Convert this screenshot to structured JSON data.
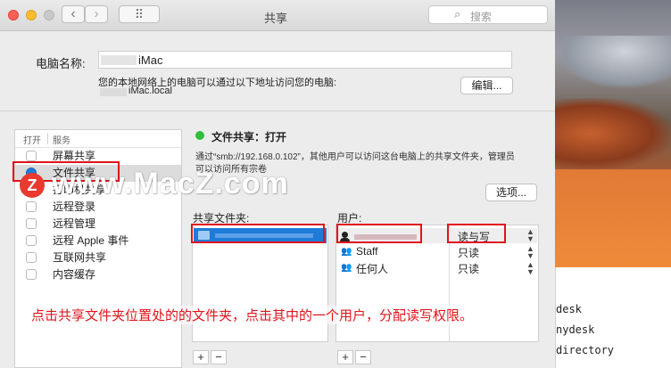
{
  "window": {
    "title": "共享",
    "back_glyph": "‹",
    "forward_glyph": "›",
    "grid_glyph": "⠿",
    "search_placeholder": "搜索",
    "search_icon_glyph": "⌕"
  },
  "computer": {
    "name_label": "电脑名称:",
    "name_value": "iMac",
    "access_text": "您的本地网络上的电脑可以通过以下地址访问您的电脑:",
    "local_address": "iMac.local",
    "edit_button": "编辑..."
  },
  "services": {
    "header_on": "打开",
    "header_service": "服务",
    "items": [
      {
        "label": "屏幕共享",
        "checked": false,
        "selected": false
      },
      {
        "label": "文件共享",
        "checked": true,
        "selected": true
      },
      {
        "label": "打印机共享",
        "checked": false,
        "selected": false
      },
      {
        "label": "远程登录",
        "checked": false,
        "selected": false
      },
      {
        "label": "远程管理",
        "checked": false,
        "selected": false
      },
      {
        "label": "远程 Apple 事件",
        "checked": false,
        "selected": false
      },
      {
        "label": "互联网共享",
        "checked": false,
        "selected": false
      },
      {
        "label": "内容缓存",
        "checked": false,
        "selected": false
      }
    ]
  },
  "file_sharing": {
    "status": "文件共享：打开",
    "status_color": "#2fbf3a",
    "description_line1": "通过“smb://192.168.0.102”，其他用户可以访问这台电脑上的共享文件夹，管理员",
    "description_line2": "可以访问所有宗卷",
    "options_button": "选项...",
    "shared_folders_label": "共享文件夹:",
    "users_label": "用户:",
    "users": [
      {
        "name": "",
        "permission": "读与写"
      },
      {
        "name": "Staff",
        "permission": "只读"
      },
      {
        "name": "任何人",
        "permission": "只读"
      }
    ],
    "add_glyph": "+",
    "remove_glyph": "−"
  },
  "watermark": "www.MacZ.com",
  "watermark_logo_letter": "Z",
  "annotation": "点击共享文件夹位置处的的文件夹，点击其中的一个用户，分配读写权限。",
  "terminal_lines": [
    "desk",
    "nydesk",
    "directory"
  ],
  "colors": {
    "accent": "#1e7bd8",
    "annotation_red": "#e0141c",
    "watermark_white": "#ffffff"
  }
}
